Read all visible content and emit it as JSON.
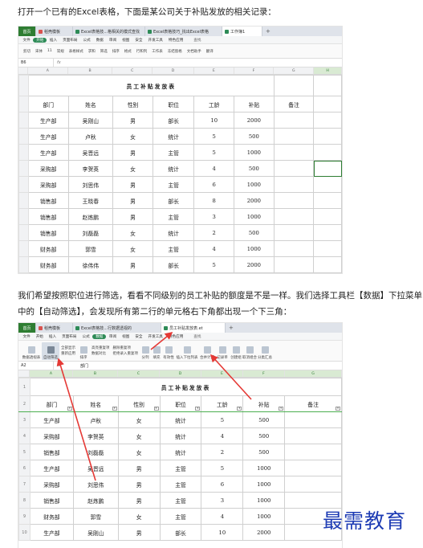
{
  "intro_text": "打开一个已有的Excel表格，下面是某公司关于补贴发放的相关记录：",
  "middle_text": "我们希望按照职位进行筛选，看看不同级别的员工补贴的额度是不是一样。我们选择工具栏【数据】下拉菜单中的【自动筛选】，会发现所有第二行的单元格右下角都出现一个下三角：",
  "watermark": "最需教育",
  "screenshot1": {
    "tabs": [
      "首页",
      "稻壳模板",
      "Excel表格技...格相关的模式查找",
      "Excel表格技巧_找出Excel表格",
      "工作簿1"
    ],
    "menus": [
      "文件",
      "开始",
      "插入",
      "页面布局",
      "公式",
      "数据",
      "审阅",
      "视图",
      "安全",
      "开发工具",
      "特色应用",
      "查找"
    ],
    "ribbon": [
      "剪切",
      "宋体",
      "11",
      "常规",
      "表格样式",
      "求和",
      "筛选",
      "排序",
      "格式",
      "行和列",
      "工作表",
      "冻结窗格",
      "文档助手",
      "翻译"
    ],
    "cell_ref": "B6",
    "columns": [
      "A",
      "B",
      "C",
      "D",
      "E",
      "F",
      "G",
      "H"
    ],
    "sheet_title": "员工补贴发放表",
    "headers": [
      "部门",
      "姓名",
      "性别",
      "职位",
      "工龄",
      "补贴",
      "备注"
    ],
    "rows": [
      [
        "生产部",
        "吴刚山",
        "男",
        "部长",
        "10",
        "2000",
        ""
      ],
      [
        "生产部",
        "卢秋",
        "女",
        "统计",
        "5",
        "500",
        ""
      ],
      [
        "生产部",
        "吴晋远",
        "男",
        "主管",
        "5",
        "1000",
        ""
      ],
      [
        "采购部",
        "李贺英",
        "女",
        "统计",
        "4",
        "500",
        ""
      ],
      [
        "采购部",
        "刘思伟",
        "男",
        "主管",
        "6",
        "1000",
        ""
      ],
      [
        "销售部",
        "王晓春",
        "男",
        "部长",
        "8",
        "2000",
        ""
      ],
      [
        "销售部",
        "赵炼鹏",
        "男",
        "主管",
        "3",
        "1000",
        ""
      ],
      [
        "销售部",
        "刘磊磊",
        "女",
        "统计",
        "2",
        "500",
        ""
      ],
      [
        "财务部",
        "郭雪",
        "女",
        "主管",
        "4",
        "1000",
        ""
      ],
      [
        "财务部",
        "徐伟伟",
        "男",
        "部长",
        "5",
        "2000",
        ""
      ]
    ]
  },
  "screenshot2": {
    "tabs": [
      "首页",
      "稻壳模板",
      "Excel表格技...行数据透视的",
      "员工补贴发放表.et"
    ],
    "menus": [
      "文件",
      "开始",
      "插入",
      "页面布局",
      "公式",
      "数据",
      "审阅",
      "视图",
      "安全",
      "开发工具",
      "特色应用",
      "查找"
    ],
    "ribbon_buttons": [
      "数据透视表",
      "自动筛选",
      "全部显示",
      "重新应用",
      "排序",
      "高亮重复项",
      "数据对比",
      "删除重复项",
      "拒绝录入重复项",
      "分列",
      "填充",
      "有效性",
      "插入下拉列表",
      "合并计算",
      "记录单",
      "创建组",
      "取消组合",
      "分类汇总"
    ],
    "cell_ref": "A2",
    "formula_content": "部门",
    "columns": [
      "A",
      "B",
      "C",
      "D",
      "E",
      "F",
      "G"
    ],
    "row_numbers": [
      "1",
      "2",
      "3",
      "4",
      "5",
      "6",
      "7",
      "8",
      "9",
      "10"
    ],
    "sheet_title": "员工补贴发放表",
    "headers": [
      "部门",
      "姓名",
      "性别",
      "职位",
      "工龄",
      "补贴",
      "备注"
    ],
    "rows": [
      [
        "生产部",
        "卢秋",
        "女",
        "统计",
        "5",
        "500",
        ""
      ],
      [
        "采购部",
        "李贺英",
        "女",
        "统计",
        "4",
        "500",
        ""
      ],
      [
        "销售部",
        "刘磊磊",
        "女",
        "统计",
        "2",
        "500",
        ""
      ],
      [
        "生产部",
        "吴晋远",
        "男",
        "主管",
        "5",
        "1000",
        ""
      ],
      [
        "采购部",
        "刘思伟",
        "男",
        "主管",
        "6",
        "1000",
        ""
      ],
      [
        "销售部",
        "赵炼鹏",
        "男",
        "主管",
        "3",
        "1000",
        ""
      ],
      [
        "财务部",
        "郭雪",
        "女",
        "主管",
        "4",
        "1000",
        ""
      ],
      [
        "生产部",
        "吴刚山",
        "男",
        "部长",
        "10",
        "2000",
        ""
      ]
    ],
    "dropdown_glyph": "▾"
  }
}
